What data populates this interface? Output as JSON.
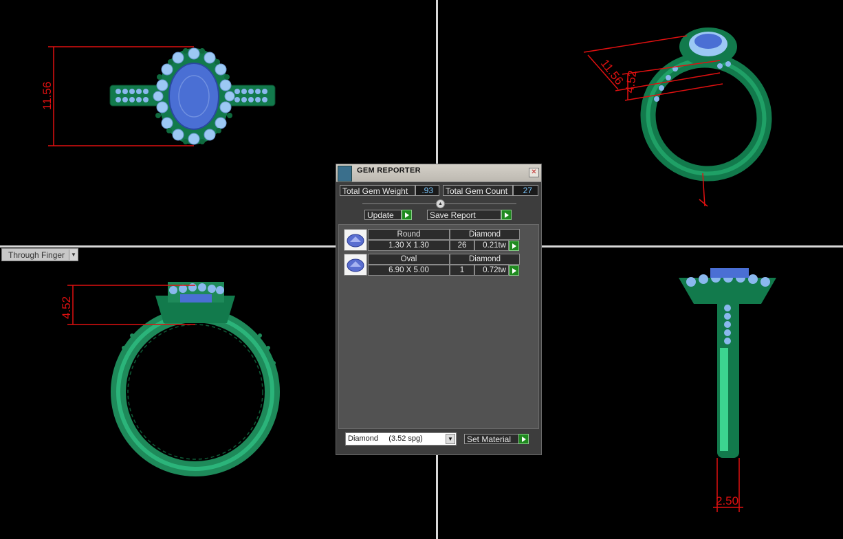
{
  "viewports": {
    "top": {
      "dimension": "11.56"
    },
    "perspective": {
      "dimension_a": "11.56",
      "dimension_b": "4.52"
    },
    "front": {
      "dimension": "4.52",
      "view_label": "Through Finger"
    },
    "side": {
      "dimension": "2.50"
    }
  },
  "gem_reporter": {
    "title": "GEM REPORTER",
    "total_gem_weight_label": "Total Gem Weight",
    "total_gem_weight": ".93",
    "total_gem_count_label": "Total Gem Count",
    "total_gem_count": "27",
    "update_label": "Update",
    "save_report_label": "Save Report",
    "gems": [
      {
        "shape": "Round",
        "material": "Diamond",
        "size": "1.30 X 1.30",
        "count": "26",
        "weight": "0.21tw"
      },
      {
        "shape": "Oval",
        "material": "Diamond",
        "size": "6.90 X 5.00",
        "count": "1",
        "weight": "0.72tw"
      }
    ],
    "material_select": "Diamond     (3.52 spg)",
    "set_material_label": "Set Material"
  },
  "colors": {
    "metal": "#1e8a5a",
    "gem_center": "#4a6fd4",
    "gem_side": "#8ab8ee",
    "dimension": "#e01010"
  }
}
